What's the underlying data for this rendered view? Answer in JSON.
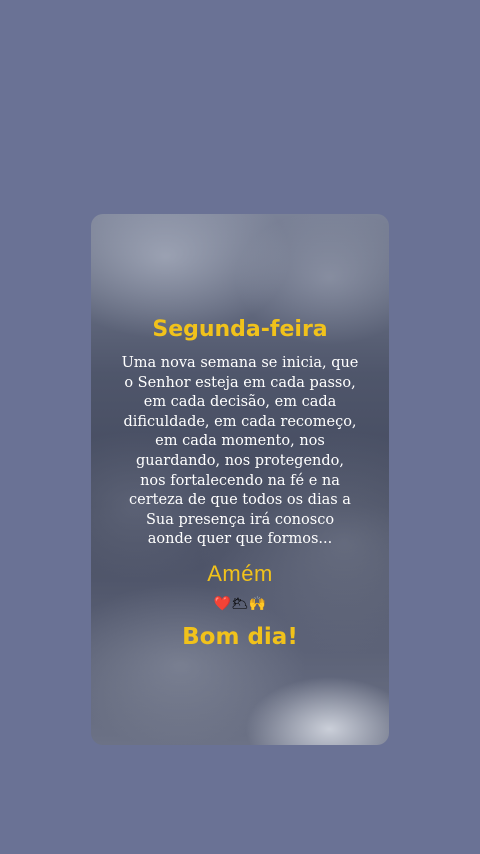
{
  "card": {
    "title": "Segunda-feira",
    "message_lines": [
      "Uma nova semana se inicia, que",
      "o Senhor esteja em cada passo,",
      "em cada decisão, em cada",
      "dificuldade, em cada recomeço,",
      "em cada momento, nos",
      "guardando, nos protegendo,",
      "nos fortalecendo na fé e na",
      "certeza de que todos os dias a",
      "Sua presença irá conosco",
      "aonde quer que formos..."
    ],
    "amen": "Amém",
    "emojis": "❤️🌥🙌",
    "greeting": "Bom dia!"
  },
  "colors": {
    "background": "#6a7295",
    "accent_yellow": "#f1c21b",
    "text_white": "#ffffff"
  }
}
